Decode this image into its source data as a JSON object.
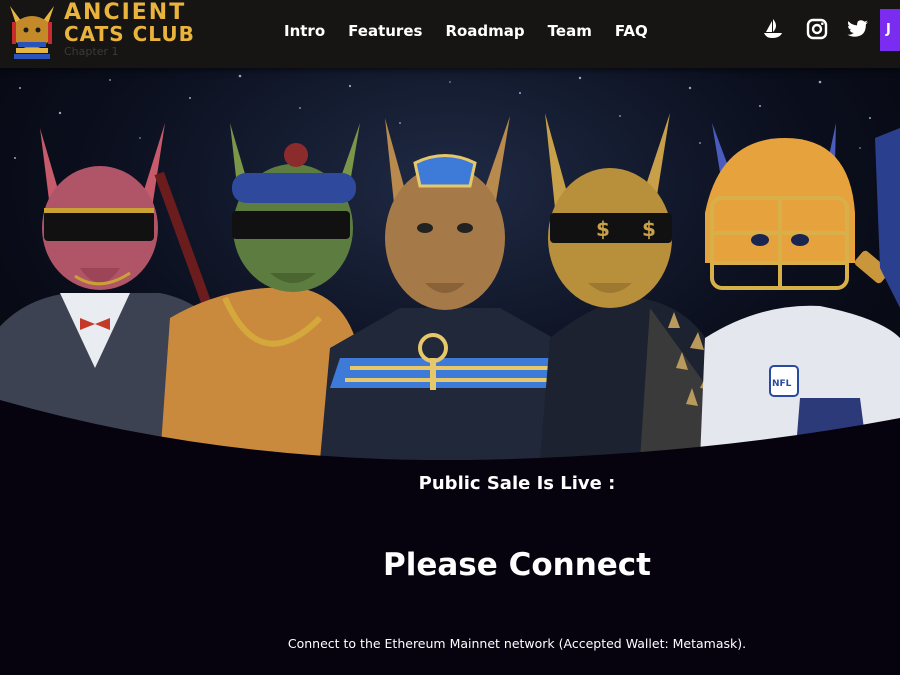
{
  "header": {
    "brand_line1": "ANCIENT",
    "brand_line2": "CATS CLUB",
    "brand_sub": "Chapter 1",
    "nav": [
      "Intro",
      "Features",
      "Roadmap",
      "Team",
      "FAQ"
    ],
    "social_icons": [
      "opensea-icon",
      "instagram-icon",
      "twitter-icon"
    ],
    "connect_stub_label": "J"
  },
  "hero": {
    "image_description_icon": "cat-characters-banner"
  },
  "sale": {
    "status_label": "Public Sale Is Live :",
    "connect_heading": "Please Connect",
    "connect_info": "Connect to the Ethereum Mainnet network (Accepted Wallet: Metamask)."
  },
  "colors": {
    "header_bg": "#161513",
    "brand_gold": "#e9b33c",
    "accent_purple": "#7a2cf0",
    "page_bg": "#06030f"
  }
}
